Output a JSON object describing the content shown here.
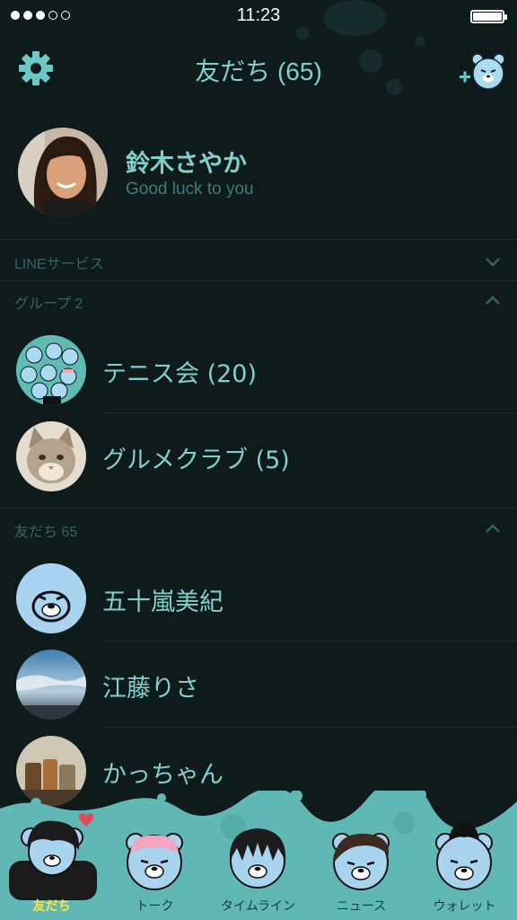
{
  "status": {
    "time": "11:23",
    "signal_filled": 3,
    "signal_total": 5,
    "battery_percent": 100
  },
  "header": {
    "title": "友だち (65)",
    "settings_icon": "gear-icon",
    "add_icon": "add-friend-icon"
  },
  "profile": {
    "name": "鈴木さやか",
    "status_message": "Good luck to you"
  },
  "sections": {
    "services": {
      "label": "LINEサービス",
      "state": "collapsed"
    },
    "groups": {
      "label": "グループ 2",
      "state": "expanded"
    },
    "friends": {
      "label": "友だち 65",
      "state": "expanded"
    }
  },
  "groups": [
    {
      "name": "テニス会 (20)",
      "avatar": "group-bears-avatar"
    },
    {
      "name": "グルメクラブ (5)",
      "avatar": "cat-avatar"
    }
  ],
  "friends": [
    {
      "name": "五十嵐美紀",
      "avatar": "bear-avatar"
    },
    {
      "name": "江藤りさ",
      "avatar": "sky-avatar"
    },
    {
      "name": "かっちゃん",
      "avatar": "jars-avatar"
    }
  ],
  "tabs": [
    {
      "label": "友だち",
      "active": true
    },
    {
      "label": "トーク",
      "active": false
    },
    {
      "label": "タイムライン",
      "active": false
    },
    {
      "label": "ニュース",
      "active": false
    },
    {
      "label": "ウォレット",
      "active": false
    }
  ],
  "colors": {
    "background": "#0f1b1b",
    "accent": "#7fd0cc",
    "muted": "#2f6664",
    "tabbar": "#5fb8b4",
    "active_tab": "#ffe34a"
  }
}
